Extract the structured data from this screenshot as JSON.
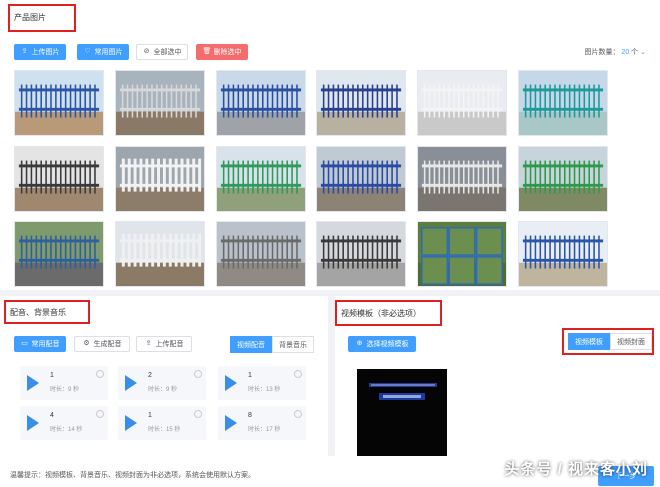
{
  "product_section": {
    "title": "产品图片",
    "buttons": {
      "upload": "上传图片",
      "favorites": "常用图片",
      "select_all": "全部选中",
      "delete_selected": "删除选中"
    },
    "count_label": "图片数量：",
    "count_value": "20",
    "count_unit": "个"
  },
  "music_section": {
    "title": "配音、背景音乐",
    "buttons": {
      "favorites": "常用配音",
      "generate": "生成配音",
      "upload": "上传配音"
    },
    "tabs": [
      "视频配音",
      "背景音乐"
    ],
    "active_tab": 0,
    "items": [
      {
        "num": "1",
        "duration": "时长：9 秒"
      },
      {
        "num": "2",
        "duration": "时长：9 秒"
      },
      {
        "num": "1",
        "duration": "时长：13 秒"
      },
      {
        "num": "4",
        "duration": "时长：14 秒"
      },
      {
        "num": "1",
        "duration": "时长：15 秒"
      },
      {
        "num": "8",
        "duration": "时长：17 秒"
      }
    ]
  },
  "template_section": {
    "title": "视频模板（非必选项）",
    "select_button": "选择视频模板",
    "tabs": [
      "视频模板",
      "视频封面"
    ],
    "active_tab": 0
  },
  "footer": {
    "tip": "温馨提示：视频模板、背景音乐、视频封面为非必选项，系统会使用默认方案。",
    "next_button": "下一步",
    "watermark": "头条号 / 视来客小刘"
  },
  "colors": {
    "primary": "#409eff",
    "danger": "#f56c6c",
    "highlight_frame": "#e02020"
  },
  "icons": [
    "upload-icon",
    "heart-icon",
    "check-circle-icon",
    "trash-icon",
    "gear-icon",
    "plus-icon",
    "play-icon"
  ]
}
